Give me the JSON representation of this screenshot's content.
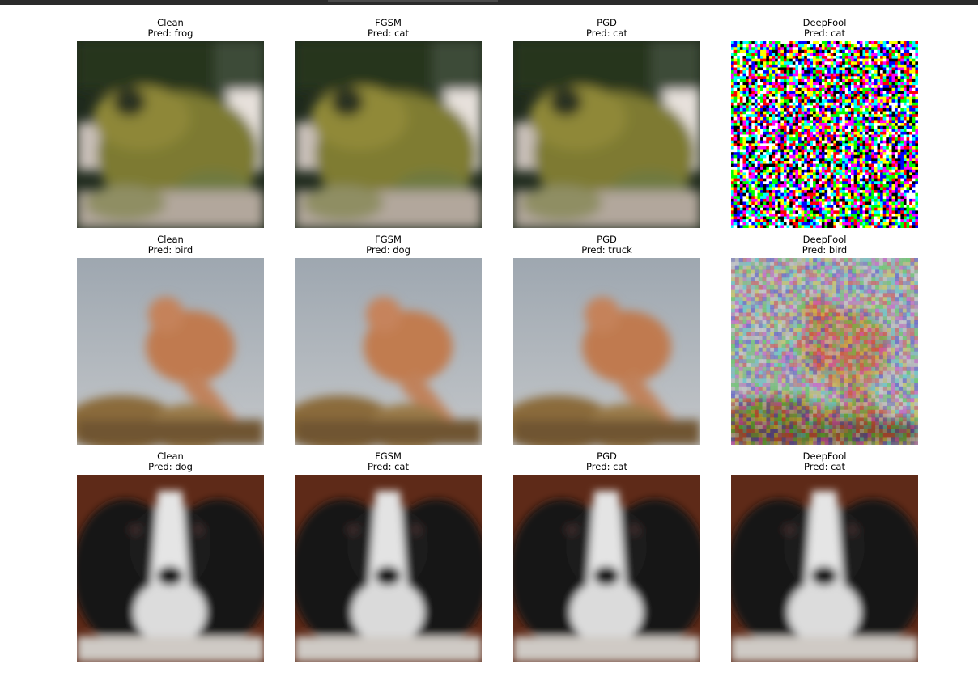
{
  "rows": [
    {
      "subject": "frog",
      "panels": [
        {
          "method": "Clean",
          "prediction": "Pred: frog"
        },
        {
          "method": "FGSM",
          "prediction": "Pred: cat"
        },
        {
          "method": "PGD",
          "prediction": "Pred: cat"
        },
        {
          "method": "DeepFool",
          "prediction": "Pred: cat"
        }
      ]
    },
    {
      "subject": "bird",
      "panels": [
        {
          "method": "Clean",
          "prediction": "Pred: bird"
        },
        {
          "method": "FGSM",
          "prediction": "Pred: dog"
        },
        {
          "method": "PGD",
          "prediction": "Pred: truck"
        },
        {
          "method": "DeepFool",
          "prediction": "Pred: bird"
        }
      ]
    },
    {
      "subject": "dog",
      "panels": [
        {
          "method": "Clean",
          "prediction": "Pred: dog"
        },
        {
          "method": "FGSM",
          "prediction": "Pred: cat"
        },
        {
          "method": "PGD",
          "prediction": "Pred: cat"
        },
        {
          "method": "DeepFool",
          "prediction": "Pred: cat"
        }
      ]
    }
  ]
}
